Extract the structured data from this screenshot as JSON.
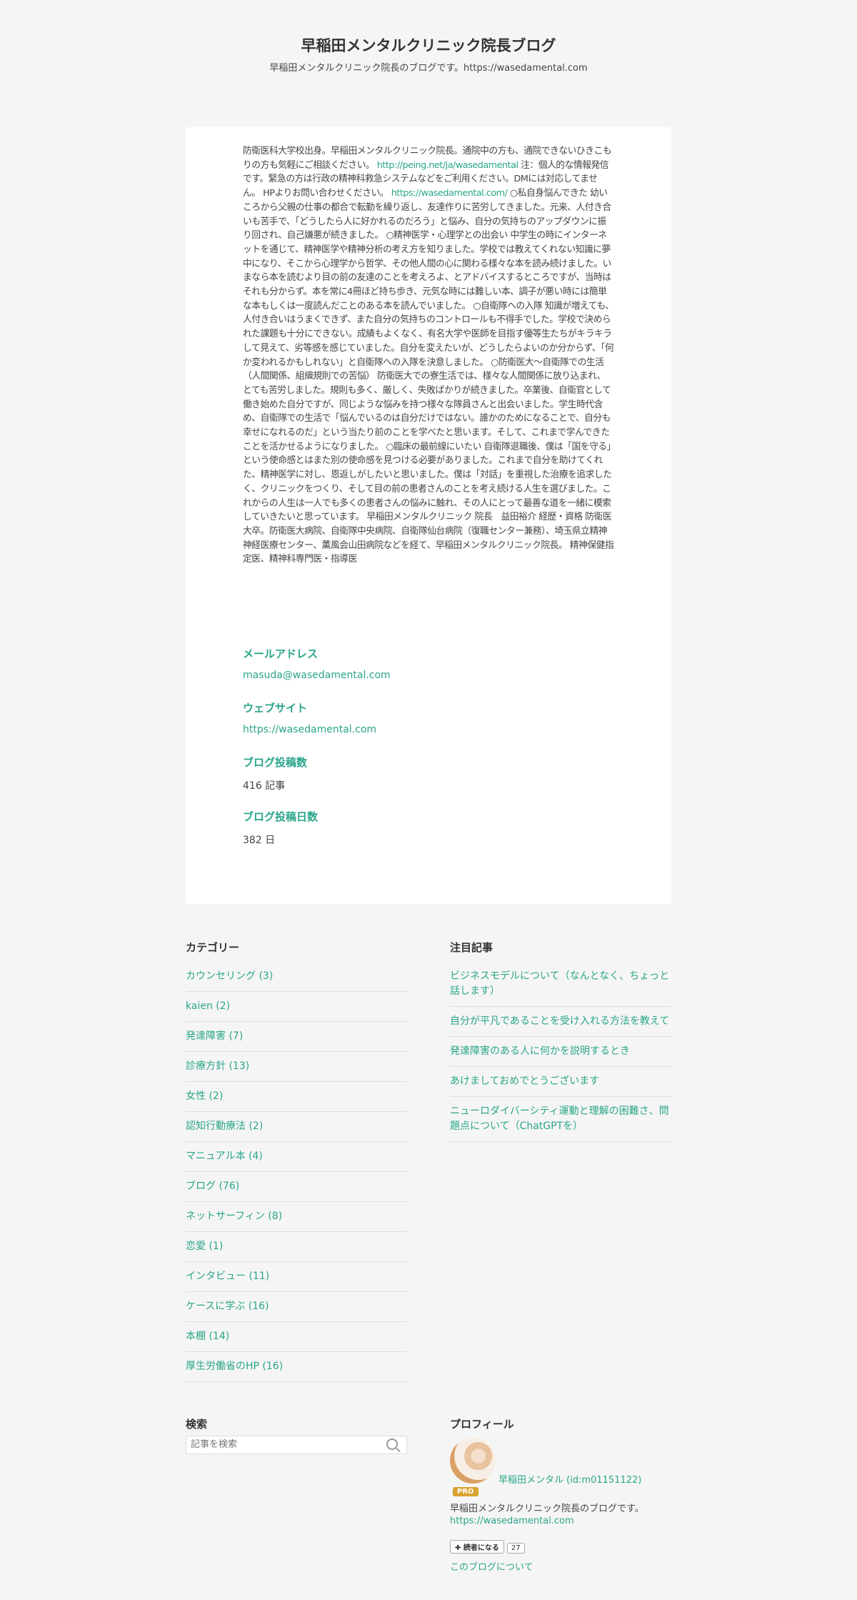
{
  "header": {
    "title": "早稲田メンタルクリニック院長ブログ",
    "description": "早稲田メンタルクリニック院長のブログです。https://wasedamental.com"
  },
  "about": {
    "text_1": "防衛医科大学校出身。早稲田メンタルクリニック院長。通院中の方も、通院できないひきこもりの方も気軽にご相談ください。 ",
    "link_1": "http://peing.net/ja/wasedamental",
    "text_2": " 注：個人的な情報発信です。緊急の方は行政の精神科救急システムなどをご利用ください。DMには対応してません。 HPよりお問い合わせください。 ",
    "link_2": "https://wasedamental.com/",
    "text_3": " ○私自身悩んできた 幼いころから父親の仕事の都合で転勤を繰り返し、友達作りに苦労してきました。元来、人付き合いも苦手で、「どうしたら人に好かれるのだろう」と悩み、自分の気持ちのアップダウンに振り回され、自己嫌悪が続きました。 ○精神医学・心理学との出会い 中学生の時にインターネットを通じて、精神医学や精神分析の考え方を知りました。学校では教えてくれない知識に夢中になり、そこから心理学から哲学、その他人間の心に関わる様々な本を読み続けました。いまなら本を読むより目の前の友達のことを考えろよ、とアドバイスするところですが、当時はそれも分からず。本を常に4冊ほど持ち歩き、元気な時には難しい本、調子が悪い時には簡単な本もしくは一度読んだことのある本を読んでいました。 ○自衛隊への入隊 知識が増えても、人付き合いはうまくできず、また自分の気持ちのコントロールも不得手でした。学校で決められた課題も十分にできない。成績もよくなく、有名大学や医師を目指す優等生たちがキラキラして見えて、劣等感を感じていました。自分を変えたいが、どうしたらよいのか分からず、「何か変われるかもしれない」と自衛隊への入隊を決意しました。 ○防衛医大〜自衛隊での生活（人間関係、組織規則での苦悩） 防衛医大での寮生活では、様々な人間関係に放り込まれ、とても苦労しました。規則も多く、厳しく、失敗ばかりが続きました。卒業後、自衛官として働き始めた自分ですが、同じような悩みを持つ様々な隊員さんと出会いました。学生時代含め、自衛隊での生活で「悩んでいるのは自分だけではない。誰かのためになることで、自分も幸せになれるのだ」という当たり前のことを学べたと思います。そして、これまで学んできたことを活かせるようになりました。 ○臨床の最前線にいたい 自衛隊退職後、僕は「国を守る」という使命感とはまた別の使命感を見つける必要がありました。これまで自分を助けてくれた、精神医学に対し、恩返しがしたいと思いました。僕は「対話」を重視した治療を追求したく、クリニックをつくり、そして目の前の患者さんのことを考え続ける人生を選びました。これからの人生は一人でも多くの患者さんの悩みに触れ、その人にとって最善な道を一緒に模索していきたいと思っています。 早稲田メンタルクリニック 院長　益田裕介 経歴・資格 防衛医大卒。防衛医大病院、自衛隊中央病院、自衛隊仙台病院（復職センター兼務）、埼玉県立精神神経医療センター、薫風会山田病院などを経て、早稲田メンタルクリニック院長。 精神保健指定医、精神科専門医・指導医",
    "email_label": "メールアドレス",
    "email_value": "masuda@wasedamental.com",
    "website_label": "ウェブサイト",
    "website_value": "https://wasedamental.com",
    "posts_label": "ブログ投稿数",
    "posts_value": "416 記事",
    "days_label": "ブログ投稿日数",
    "days_value": "382 日"
  },
  "categories": {
    "heading": "カテゴリー",
    "items": [
      "カウンセリング (3)",
      "kaien (2)",
      "発達障害 (7)",
      "診療方針 (13)",
      "女性 (2)",
      "認知行動療法 (2)",
      "マニュアル本 (4)",
      "ブログ (76)",
      "ネットサーフィン (8)",
      "恋愛 (1)",
      "インタビュー (11)",
      "ケースに学ぶ (16)",
      "本棚 (14)",
      "厚生労働省のHP (16)"
    ]
  },
  "featured": {
    "heading": "注目記事",
    "items": [
      "ビジネスモデルについて（なんとなく、ちょっと話します）",
      "自分が平凡であることを受け入れる方法を教えて",
      "発達障害のある人に何かを説明するとき",
      "あけましておめでとうございます",
      "ニューロダイバーシティ運動と理解の困難さ、問題点について（ChatGPTを）"
    ]
  },
  "search": {
    "heading": "検索",
    "placeholder": "記事を検索",
    "icon": "search-icon"
  },
  "profile": {
    "heading": "プロフィール",
    "name": "早稲田メンタル (id:m01151122)",
    "badge": "PRO",
    "description": "早稲田メンタルクリニック院長のブログです。",
    "url": "https://wasedamental.com",
    "subscribe_label": "✚ 読者になる",
    "subscribe_count": "27",
    "about_link": "このブログについて"
  },
  "colors": {
    "accent": "#2aa58a",
    "background": "#f5f5f5",
    "badge": "#d9a22e"
  }
}
